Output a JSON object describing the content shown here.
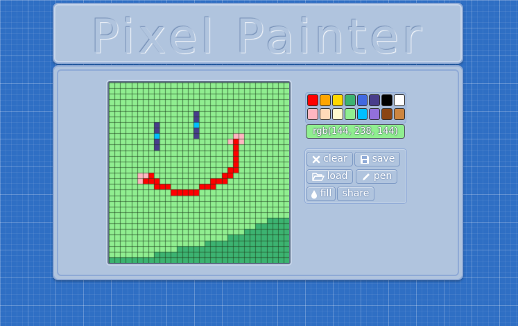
{
  "app": {
    "title": "Pixel Painter"
  },
  "palette": {
    "row1": [
      "#ff0000",
      "#ffa500",
      "#ffd700",
      "#3cb371",
      "#4169e1",
      "#483d8b",
      "#000000",
      "#ffffff"
    ],
    "row2": [
      "#ffb6c1",
      "#ffdab9",
      "#fffacd",
      "#90ee90",
      "#00bfff",
      "#9370db",
      "#8b4513",
      "#cd853f"
    ]
  },
  "current_color": {
    "label": "rgb(144, 238, 144)",
    "hex": "#90ee90"
  },
  "tools": {
    "clear": {
      "label": "clear",
      "icon": "x-icon"
    },
    "save": {
      "label": "save",
      "icon": "floppy-disk-icon"
    },
    "load": {
      "label": "load",
      "icon": "folder-open-icon"
    },
    "pen": {
      "label": "pen",
      "icon": "pencil-icon"
    },
    "fill": {
      "label": "fill",
      "icon": "droplet-icon"
    },
    "share": {
      "label": "share"
    }
  },
  "canvas": {
    "grid_size": 32,
    "background": "#90ee90",
    "gridline_color": "#1b3a1b",
    "hill_color": "#3cb371",
    "hill_heights": [
      1,
      1,
      1,
      1,
      1,
      1,
      1,
      1,
      2,
      2,
      2,
      2,
      3,
      3,
      3,
      3,
      3,
      4,
      4,
      4,
      4,
      5,
      5,
      5,
      6,
      6,
      7,
      7,
      8,
      8,
      8,
      8
    ],
    "pixels": [
      {
        "color": "#483d8b",
        "cells": [
          [
            8,
            7
          ],
          [
            8,
            8
          ],
          [
            8,
            10
          ],
          [
            8,
            11
          ],
          [
            15,
            5
          ],
          [
            15,
            6
          ],
          [
            15,
            8
          ],
          [
            15,
            9
          ]
        ]
      },
      {
        "color": "#00bfff",
        "cells": [
          [
            8,
            9
          ],
          [
            15,
            7
          ]
        ]
      },
      {
        "color": "#ffb6c1",
        "cells": [
          [
            5,
            16
          ],
          [
            6,
            16
          ],
          [
            5,
            17
          ],
          [
            22,
            9
          ],
          [
            23,
            9
          ],
          [
            21,
            10
          ],
          [
            23,
            10
          ]
        ]
      },
      {
        "color": "#ff0000",
        "cells": [
          [
            22,
            10
          ],
          [
            22,
            11
          ],
          [
            22,
            12
          ],
          [
            22,
            13
          ],
          [
            22,
            14
          ],
          [
            22,
            15
          ],
          [
            21,
            15
          ],
          [
            21,
            16
          ],
          [
            20,
            16
          ],
          [
            20,
            17
          ],
          [
            19,
            17
          ],
          [
            18,
            17
          ],
          [
            18,
            18
          ],
          [
            17,
            18
          ],
          [
            16,
            18
          ],
          [
            15,
            19
          ],
          [
            14,
            19
          ],
          [
            13,
            19
          ],
          [
            12,
            19
          ],
          [
            11,
            19
          ],
          [
            10,
            18
          ],
          [
            9,
            18
          ],
          [
            8,
            18
          ],
          [
            8,
            17
          ],
          [
            7,
            17
          ],
          [
            7,
            16
          ],
          [
            6,
            17
          ]
        ]
      }
    ]
  }
}
